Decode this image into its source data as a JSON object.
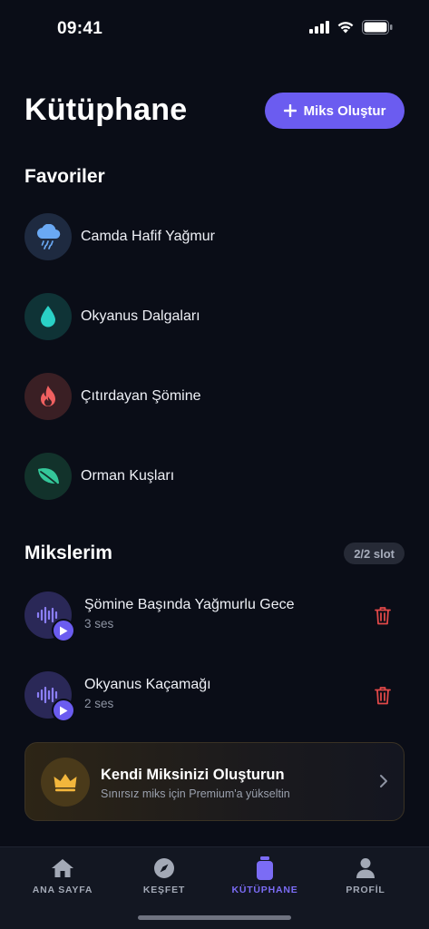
{
  "status_bar": {
    "time": "09:41"
  },
  "header": {
    "title": "Kütüphane",
    "create_button": "Miks Oluştur"
  },
  "favorites": {
    "title": "Favoriler",
    "items": [
      {
        "label": "Camda Hafif Yağmur",
        "icon": "rain-cloud-icon",
        "color": "#6aa9f4"
      },
      {
        "label": "Okyanus Dalgaları",
        "icon": "water-drop-icon",
        "color": "#2ad1c6"
      },
      {
        "label": "Çıtırdayan Şömine",
        "icon": "fire-icon",
        "color": "#f06060"
      },
      {
        "label": "Orman Kuşları",
        "icon": "leaf-icon",
        "color": "#34c79a"
      }
    ]
  },
  "mixes": {
    "title": "Mikslerim",
    "slot_badge": "2/2 slot",
    "items": [
      {
        "name": "Şömine Başında Yağmurlu Gece",
        "count": "3 ses"
      },
      {
        "name": "Okyanus Kaçamağı",
        "count": "2 ses"
      }
    ]
  },
  "premium": {
    "title": "Kendi Miksinizi Oluşturun",
    "subtitle": "Sınırsız miks için Premium'a yükseltin"
  },
  "tab_bar": {
    "tabs": [
      {
        "label": "ANA SAYFA",
        "icon": "home-icon"
      },
      {
        "label": "KEŞFET",
        "icon": "compass-icon"
      },
      {
        "label": "KÜTÜPHANE",
        "icon": "library-icon",
        "active": true
      },
      {
        "label": "PROFİL",
        "icon": "profile-icon"
      }
    ]
  },
  "colors": {
    "accent": "#6b5cf0",
    "background": "#0a0d17",
    "delete": "#e04848",
    "crown": "#f2b63c"
  }
}
